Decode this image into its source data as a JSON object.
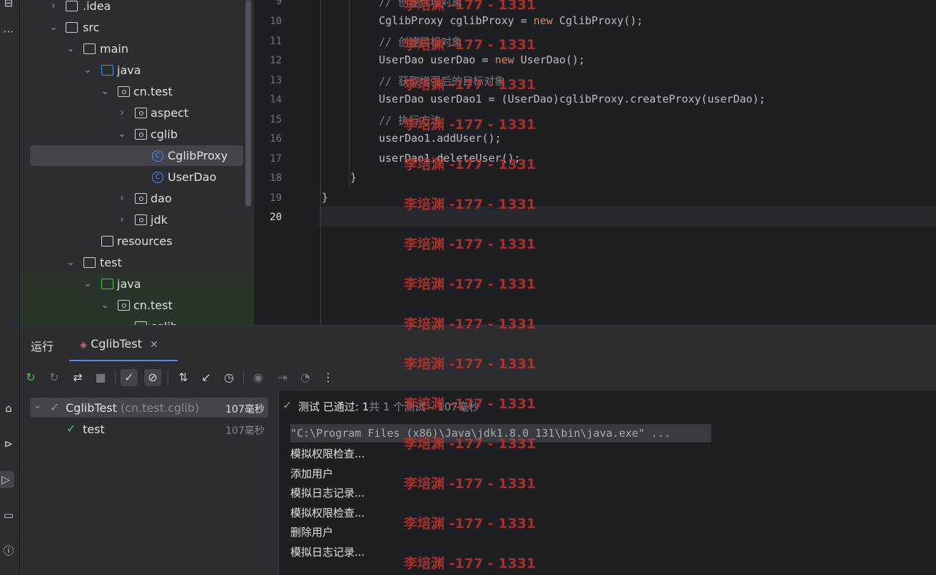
{
  "project_tree": {
    "items": [
      {
        "label": ".idea"
      },
      {
        "label": "src"
      },
      {
        "label": "main"
      },
      {
        "label": "java"
      },
      {
        "label": "cn.test"
      },
      {
        "label": "aspect"
      },
      {
        "label": "cglib"
      },
      {
        "label": "CglibProxy"
      },
      {
        "label": "UserDao"
      },
      {
        "label": "dao"
      },
      {
        "label": "jdk"
      },
      {
        "label": "resources"
      },
      {
        "label": "test"
      },
      {
        "label": "java"
      },
      {
        "label": "cn.test"
      },
      {
        "label": "cglib"
      }
    ]
  },
  "editor": {
    "line_numbers": [
      "9",
      "10",
      "11",
      "12",
      "13",
      "14",
      "15",
      "16",
      "17",
      "18",
      "19",
      "20"
    ],
    "current_line": "20",
    "lines": {
      "l9_comment": "// 创建代理对象",
      "l10_a": "CglibProxy cglibProxy = ",
      "l10_kw": "new",
      "l10_b": " CglibProxy();",
      "l11_comment": "// 创建目标对象",
      "l12_a": "UserDao userDao = ",
      "l12_kw": "new",
      "l12_b": " UserDao();",
      "l13_comment": "// 获取增强后的目标对象",
      "l14": "UserDao userDao1 = (UserDao)cglibProxy.createProxy(userDao);",
      "l15_comment": "// 执行方法",
      "l16": "userDao1.addUser();",
      "l17": "userDao1.deleteUser();",
      "l18": "}",
      "l19": "}"
    }
  },
  "bottom_panel": {
    "run_tab_label": "运行",
    "config_tab_label": "CglibTest",
    "toolbar_icons": [
      "rerun-icon",
      "rerun-failed-icon",
      "toggle-auto-test-icon",
      "stop-icon",
      "show-passed-icon",
      "show-ignored-icon",
      "sort-icon",
      "collapse-icon",
      "history-icon",
      "screenshot-icon",
      "import-icon",
      "coverage-icon",
      "more-icon"
    ]
  },
  "test_tree": {
    "root_label": "CglibTest",
    "root_package": "(cn.test.cglib)",
    "root_time": "107毫秒",
    "child_label": "test",
    "child_time": "107毫秒"
  },
  "console": {
    "status_passed": "测试 已通过: 1",
    "status_rest": "共 1 个测试 – 107毫秒",
    "command": "\"C:\\Program Files (x86)\\Java\\jdk1.8.0_131\\bin\\java.exe\" ...",
    "output": [
      "模拟权限检查...",
      "添加用户",
      "模拟日志记录...",
      "模拟权限检查...",
      "删除用户",
      "模拟日志记录..."
    ]
  },
  "watermark": "李培渊 -177 - 1331"
}
